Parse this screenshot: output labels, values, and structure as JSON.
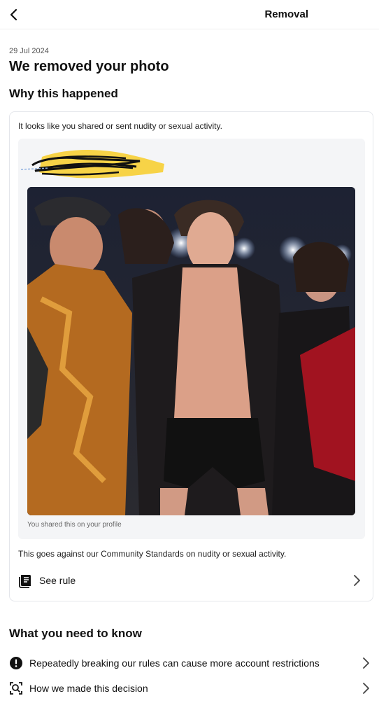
{
  "header": {
    "title": "Removal",
    "back_icon": "chevron-left-icon"
  },
  "notice": {
    "date": "29 Jul 2024",
    "title": "We removed your photo"
  },
  "why": {
    "heading": "Why this happened",
    "intro": "It looks like you shared or sent nudity or sexual activity.",
    "post": {
      "redaction_color": "#f7d13d",
      "caption": "You shared this on your profile"
    },
    "standards_text": "This goes against our Community Standards on nudity or sexual activity.",
    "see_rule": {
      "label": "See rule",
      "icon": "rulebook-icon"
    }
  },
  "know": {
    "heading": "What you need to know",
    "items": [
      {
        "label": "Repeatedly breaking our rules can cause more account restrictions",
        "icon": "alert-icon"
      },
      {
        "label": "How we made this decision",
        "icon": "face-scan-icon"
      }
    ]
  }
}
